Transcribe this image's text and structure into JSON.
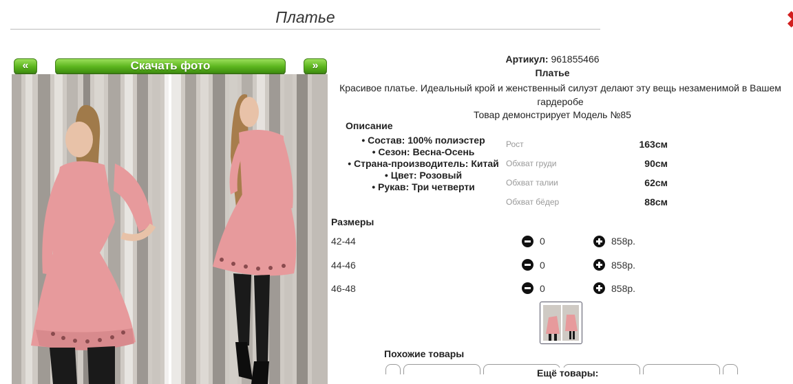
{
  "page": {
    "title": "Платье"
  },
  "gallery": {
    "prev_label": "«",
    "next_label": "»",
    "download_label": "Скачать фото"
  },
  "product": {
    "article_label": "Артикул:",
    "article": "961855466",
    "name": "Платье",
    "tagline": "Красивое платье. Идеальный крой и женственный силуэт делают эту вещь незаменимой в Вашем гардеробе",
    "model_text": "Товар демонстрирует Модель №85"
  },
  "description": {
    "title": "Описание",
    "items": [
      "Состав: 100% полиэстер",
      "Сезон: Весна-Осень",
      "Страна-производитель: Китай",
      "Цвет: Розовый",
      "Рукав: Три четверти"
    ]
  },
  "measurements": [
    {
      "label": "Рост",
      "value": "163см"
    },
    {
      "label": "Обхват груди",
      "value": "90см"
    },
    {
      "label": "Обхват талии",
      "value": "62см"
    },
    {
      "label": "Обхват бёдер",
      "value": "88см"
    }
  ],
  "sizes": {
    "title": "Размеры",
    "rows": [
      {
        "size": "42-44",
        "qty": "0",
        "price": "858р."
      },
      {
        "size": "44-46",
        "qty": "0",
        "price": "858р."
      },
      {
        "size": "46-48",
        "qty": "0",
        "price": "858р."
      }
    ]
  },
  "similar": {
    "title": "Похожие товары",
    "more_label": "Ещё товары:"
  },
  "colors": {
    "accent_green": "#5cb51e",
    "dress_pink": "#e79a9c",
    "close_red": "#d21f1f"
  }
}
